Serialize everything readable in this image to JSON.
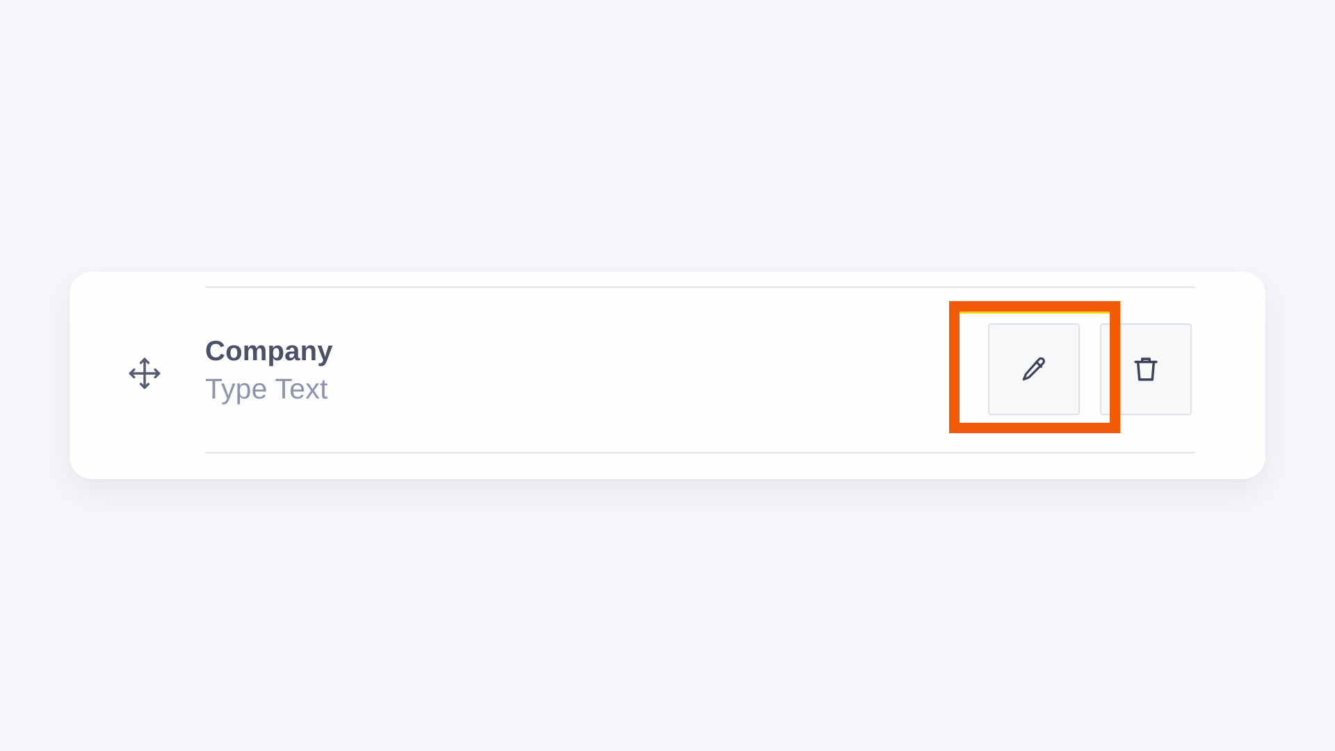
{
  "field": {
    "name": "Company",
    "type_label": "Type Text"
  },
  "icons": {
    "drag": "move-arrows-icon",
    "edit": "pencil-icon",
    "delete": "trash-icon"
  },
  "colors": {
    "background": "#f5f6fa",
    "card": "#fdfefd",
    "label": "#4a5068",
    "sublabel": "#8c94ae",
    "highlight": "#f35a05"
  }
}
